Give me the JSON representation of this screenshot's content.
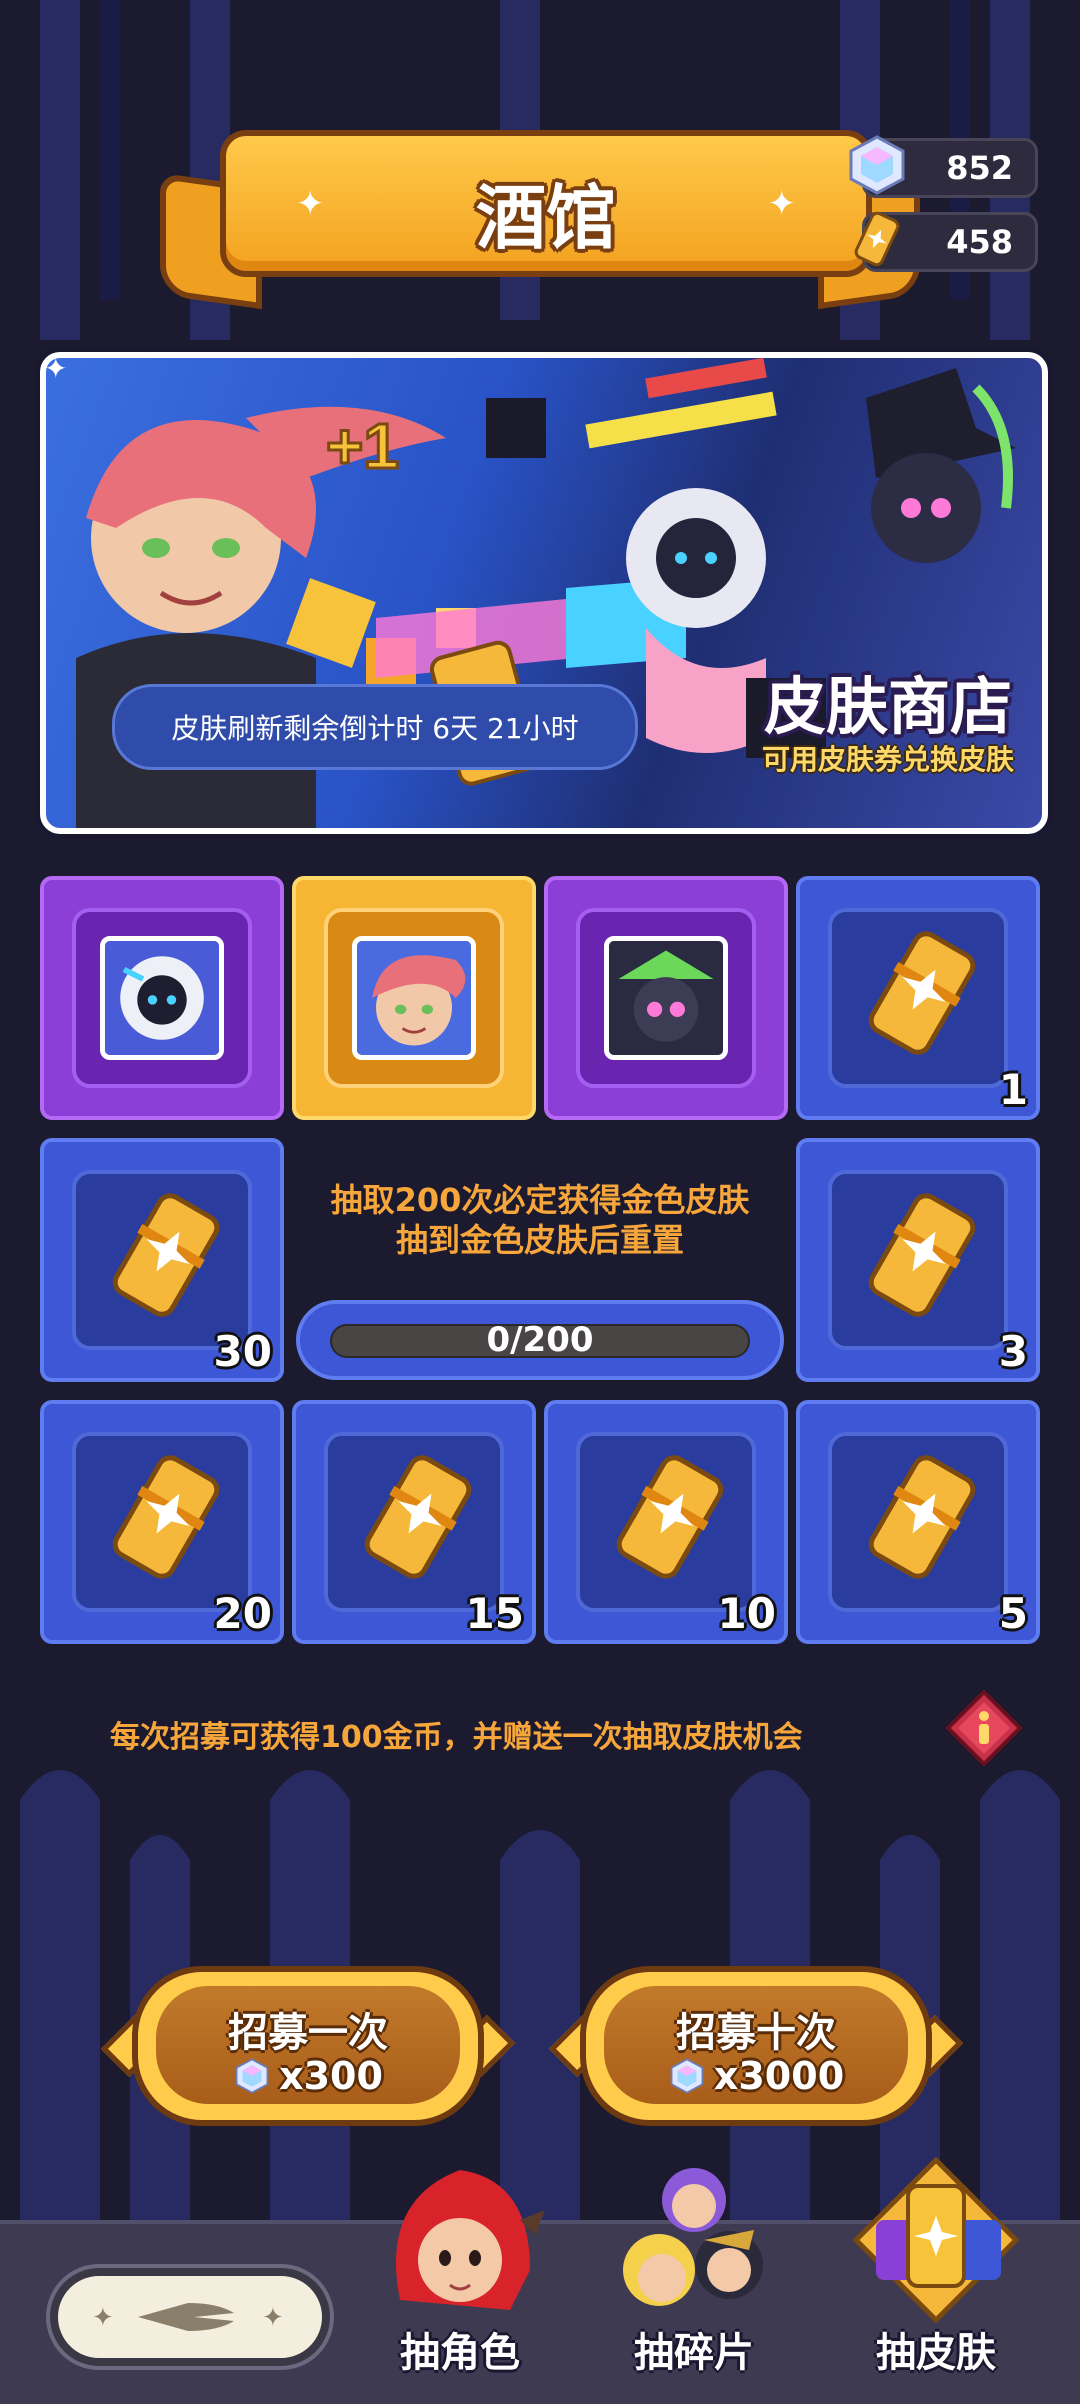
{
  "header": {
    "title": "酒馆"
  },
  "currency": [
    {
      "icon": "diamond-gem-icon",
      "value": "852"
    },
    {
      "icon": "skin-ticket-icon",
      "value": "458"
    }
  ],
  "shop_banner": {
    "plus_text": "+1",
    "countdown": "皮肤刷新剩余倒计时  6天 21小时",
    "title": "皮肤商店",
    "subtitle": "可用皮肤券兑换皮肤"
  },
  "grid": {
    "row1": [
      {
        "type": "portrait",
        "rarity": "purple",
        "icon": "robot-hero-portrait"
      },
      {
        "type": "portrait",
        "rarity": "gold",
        "icon": "pink-hair-girl-portrait"
      },
      {
        "type": "portrait",
        "rarity": "purple",
        "icon": "witch-robot-portrait"
      },
      {
        "type": "ticket",
        "count": "1"
      }
    ],
    "left_mid": {
      "type": "ticket",
      "count": "30"
    },
    "right_mid": {
      "type": "ticket",
      "count": "3"
    },
    "row3": [
      {
        "type": "ticket",
        "count": "20"
      },
      {
        "type": "ticket",
        "count": "15"
      },
      {
        "type": "ticket",
        "count": "10"
      },
      {
        "type": "ticket",
        "count": "5"
      }
    ]
  },
  "pity": {
    "line1": "抽取200次必定获得金色皮肤",
    "line2": "抽到金色皮肤后重置",
    "progress_text": "0/200",
    "progress_fraction": 0
  },
  "notice": "每次招募可获得100金币，并赠送一次抽取皮肤机会",
  "recruit": [
    {
      "label": "招募一次",
      "cost": "x300"
    },
    {
      "label": "招募十次",
      "cost": "x3000"
    }
  ],
  "nav": [
    {
      "label": "抽角色"
    },
    {
      "label": "抽碎片"
    },
    {
      "label": "抽皮肤"
    }
  ],
  "colors": {
    "background": "#1c1a2e",
    "accent_gold": "#f6a63a",
    "tile_blue": "#3d57d6",
    "tile_purple": "#8c3fd6",
    "tile_gold": "#f7b534"
  }
}
